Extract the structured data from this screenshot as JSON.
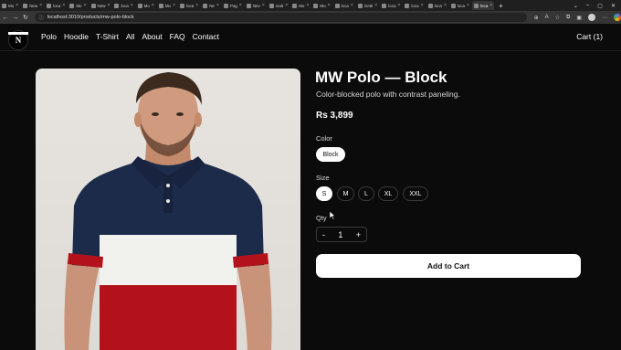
{
  "browser": {
    "tabs": [
      {
        "label": "Mo"
      },
      {
        "label": "New"
      },
      {
        "label": "loca"
      },
      {
        "label": "Mo"
      },
      {
        "label": "New"
      },
      {
        "label": "loca"
      },
      {
        "label": "Mo"
      },
      {
        "label": "Mo"
      },
      {
        "label": "loca"
      },
      {
        "label": "Ne"
      },
      {
        "label": "Pag"
      },
      {
        "label": "Nev"
      },
      {
        "label": "mult"
      },
      {
        "label": "Mo"
      },
      {
        "label": "Mo"
      },
      {
        "label": "loca"
      },
      {
        "label": "Getti"
      },
      {
        "label": "loca"
      },
      {
        "label": "loca"
      },
      {
        "label": "loca"
      },
      {
        "label": "loca"
      },
      {
        "label": "loca"
      }
    ],
    "active_tab_index": 21,
    "new_tab_label": "+",
    "url": "localhost:3010/products/mw-polo-block"
  },
  "header": {
    "logo_letter": "N",
    "nav_items": [
      "Polo",
      "Hoodie",
      "T-Shirt",
      "All",
      "About",
      "FAQ",
      "Contact"
    ],
    "cart_label": "Cart (1)"
  },
  "product": {
    "title": "MW Polo — Block",
    "subtitle": "Color-blocked polo with contrast paneling.",
    "price": "Rs 3,899",
    "color_label": "Color",
    "colors": [
      "Block"
    ],
    "selected_color": "Block",
    "size_label": "Size",
    "sizes": [
      "S",
      "M",
      "L",
      "XL",
      "XXL"
    ],
    "selected_size": "S",
    "qty_label": "Qty",
    "qty_minus": "-",
    "qty_value": "1",
    "qty_plus": "+",
    "add_to_cart_label": "Add to Cart"
  },
  "colors": {
    "page_bg": "#0b0b0b",
    "polo_navy": "#1c2b4a",
    "polo_white": "#f1f1ee",
    "polo_red": "#b3121b"
  }
}
